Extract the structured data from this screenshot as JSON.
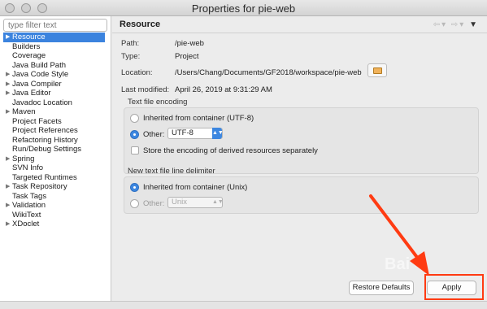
{
  "window": {
    "title": "Properties for pie-web"
  },
  "sidebar": {
    "filter_placeholder": "type filter text",
    "items": [
      {
        "label": "Resource",
        "expandable": true,
        "selected": true
      },
      {
        "label": "Builders",
        "expandable": false
      },
      {
        "label": "Coverage",
        "expandable": false
      },
      {
        "label": "Java Build Path",
        "expandable": false
      },
      {
        "label": "Java Code Style",
        "expandable": true
      },
      {
        "label": "Java Compiler",
        "expandable": true
      },
      {
        "label": "Java Editor",
        "expandable": true
      },
      {
        "label": "Javadoc Location",
        "expandable": false
      },
      {
        "label": "Maven",
        "expandable": true
      },
      {
        "label": "Project Facets",
        "expandable": false
      },
      {
        "label": "Project References",
        "expandable": false
      },
      {
        "label": "Refactoring History",
        "expandable": false
      },
      {
        "label": "Run/Debug Settings",
        "expandable": false
      },
      {
        "label": "Spring",
        "expandable": true
      },
      {
        "label": "SVN Info",
        "expandable": false
      },
      {
        "label": "Targeted Runtimes",
        "expandable": false
      },
      {
        "label": "Task Repository",
        "expandable": true
      },
      {
        "label": "Task Tags",
        "expandable": false
      },
      {
        "label": "Validation",
        "expandable": true
      },
      {
        "label": "WikiText",
        "expandable": false
      },
      {
        "label": "XDoclet",
        "expandable": true
      }
    ]
  },
  "main": {
    "title": "Resource",
    "nav": {
      "back": "⇦▾",
      "forward": "⇨▾",
      "menu": "▼"
    },
    "path": {
      "label": "Path:",
      "value": "/pie-web"
    },
    "type": {
      "label": "Type:",
      "value": "Project"
    },
    "location": {
      "label": "Location:",
      "value": "/Users/Chang/Documents/GF2018/workspace/pie-web"
    },
    "modified": {
      "label": "Last modified:",
      "value": "April 26, 2019 at 9:31:29 AM"
    },
    "encoding": {
      "section_label": "Text file encoding",
      "inherited_label": "Inherited from container (UTF-8)",
      "other_label": "Other:",
      "other_value": "UTF-8",
      "store_label": "Store the encoding of derived resources separately",
      "selected": "other"
    },
    "delimiter": {
      "section_label": "New text file line delimiter",
      "inherited_label": "Inherited from container (Unix)",
      "other_label": "Other:",
      "other_value": "Unix",
      "selected": "inherited"
    },
    "buttons": {
      "restore": "Restore Defaults",
      "apply": "Apply"
    },
    "watermark": "Bai"
  },
  "colors": {
    "accent": "#3b83de",
    "highlight": "#ff3b12"
  }
}
